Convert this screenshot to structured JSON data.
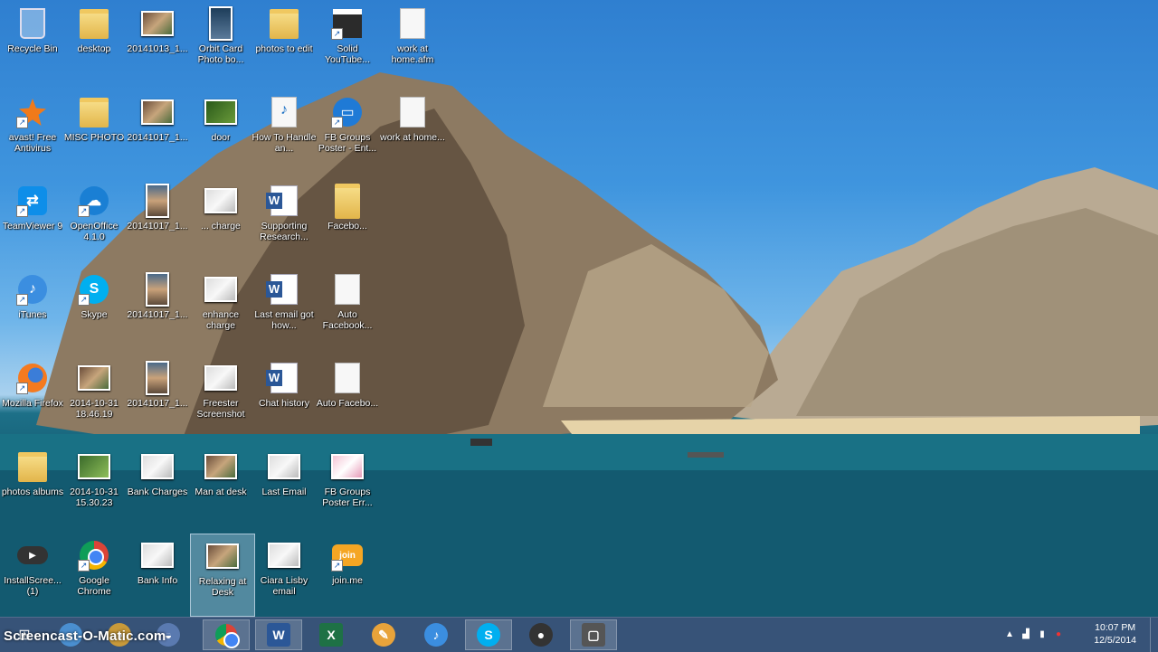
{
  "desktop": {
    "icons": [
      {
        "label": "Recycle Bin"
      },
      {
        "label": "desktop"
      },
      {
        "label": "20141013_1..."
      },
      {
        "label": "Orbit Card Photo bo..."
      },
      {
        "label": "photos to edit"
      },
      {
        "label": "Solid YouTube..."
      },
      {
        "label": "work at home.afm"
      },
      {
        "label": "avast! Free Antivirus"
      },
      {
        "label": "MISC PHOTO"
      },
      {
        "label": "20141017_1..."
      },
      {
        "label": "door"
      },
      {
        "label": "How To Handle an..."
      },
      {
        "label": "FB Groups Poster - Ent..."
      },
      {
        "label": "work at home..."
      },
      {
        "label": "TeamViewer 9"
      },
      {
        "label": "OpenOffice 4.1.0"
      },
      {
        "label": "20141017_1..."
      },
      {
        "label": "... charge"
      },
      {
        "label": "Supporting Research..."
      },
      {
        "label": "Facebo..."
      },
      {
        "label": "iTunes"
      },
      {
        "label": "Skype"
      },
      {
        "label": "20141017_1..."
      },
      {
        "label": "enhance charge"
      },
      {
        "label": "Last email got how..."
      },
      {
        "label": "Auto Facebook..."
      },
      {
        "label": "Mozilla Firefox"
      },
      {
        "label": "2014-10-31 18.46.19"
      },
      {
        "label": "20141017_1..."
      },
      {
        "label": "Freester Screenshot"
      },
      {
        "label": "Chat history"
      },
      {
        "label": "Auto Facebo..."
      },
      {
        "label": "photos albums"
      },
      {
        "label": "2014-10-31 15.30.23"
      },
      {
        "label": "Bank Charges"
      },
      {
        "label": "Man at desk"
      },
      {
        "label": "Last Email"
      },
      {
        "label": "FB Groups Poster Err..."
      },
      {
        "label": "InstallScree... (1)"
      },
      {
        "label": "Google Chrome"
      },
      {
        "label": "Bank Info"
      },
      {
        "label": "Relaxing at Desk"
      },
      {
        "label": "Ciara Lisby email"
      },
      {
        "label": "join.me"
      }
    ]
  },
  "taskbar": {
    "watermark": "Screencast-O-Matic.com",
    "buttons": [
      {
        "name": "chrome",
        "glyph": ""
      },
      {
        "name": "word",
        "glyph": "W"
      },
      {
        "name": "excel",
        "glyph": "X"
      },
      {
        "name": "paint",
        "glyph": "✎"
      },
      {
        "name": "itunes",
        "glyph": "♪"
      },
      {
        "name": "skype",
        "glyph": "S"
      },
      {
        "name": "screencast",
        "glyph": "●"
      },
      {
        "name": "snipping",
        "glyph": "▢"
      }
    ],
    "tray": {
      "time": "10:07 PM",
      "date": "12/5/2014"
    }
  },
  "colors": {
    "taskbar": "#284670",
    "sky": "#3f95de",
    "sea": "#13596e"
  }
}
